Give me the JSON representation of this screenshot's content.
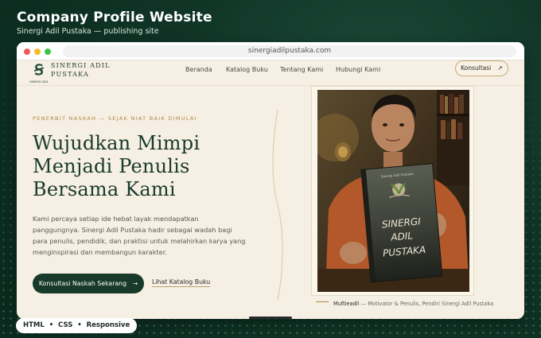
{
  "header": {
    "title": "Company Profile Website",
    "subtitle": "Sinergi Adil Pustaka — publishing site"
  },
  "browser": {
    "url": "sinergiadilpustaka.com"
  },
  "site": {
    "logo_mini": "SINERGI ADIL",
    "brand_line1": "SINERGI ADIL",
    "brand_line2": "PUSTAKA",
    "nav": {
      "items": [
        "Beranda",
        "Katalog Buku",
        "Tentang Kami",
        "Hubungi Kami"
      ],
      "cta_label": "Konsultasi",
      "cta_icon": "↗"
    },
    "hero": {
      "kicker": "PENERBIT NASKAH — SEJAK NIAT BAIK DIMULAI",
      "headline_line1": "Wujudkan Mimpi",
      "headline_line2": "Menjadi Penulis",
      "headline_line3": "Bersama Kami",
      "paragraph": "Kami percaya setiap ide hebat layak mendapatkan panggungnya. Sinergi Adil Pustaka hadir sebagai wadah bagi para penulis, pendidik, dan praktisi untuk melahirkan karya yang menginspirasi dan membangun karakter.",
      "primary_cta": "Konsultasi Naskah Sekarang",
      "primary_cta_icon": "→",
      "secondary_link": "Lihat Katalog Buku"
    },
    "photo": {
      "book_cover_small": "Sinergi Adil Pustaka",
      "book_title_1": "SINERGI",
      "book_title_2": "ADIL",
      "book_title_3": "PUSTAKA"
    },
    "caption": {
      "name": "Muftieadil",
      "role": " — Motivator & Penulis, Pendiri Sinergi Adil Pustaka"
    }
  },
  "footer_pill": {
    "text": "HTML  •  CSS  •  Responsive"
  },
  "colors": {
    "background": "#0f3426",
    "primary_green": "#173a2b",
    "accent_gold": "#b08a43",
    "page_cream": "#f6efe3"
  }
}
